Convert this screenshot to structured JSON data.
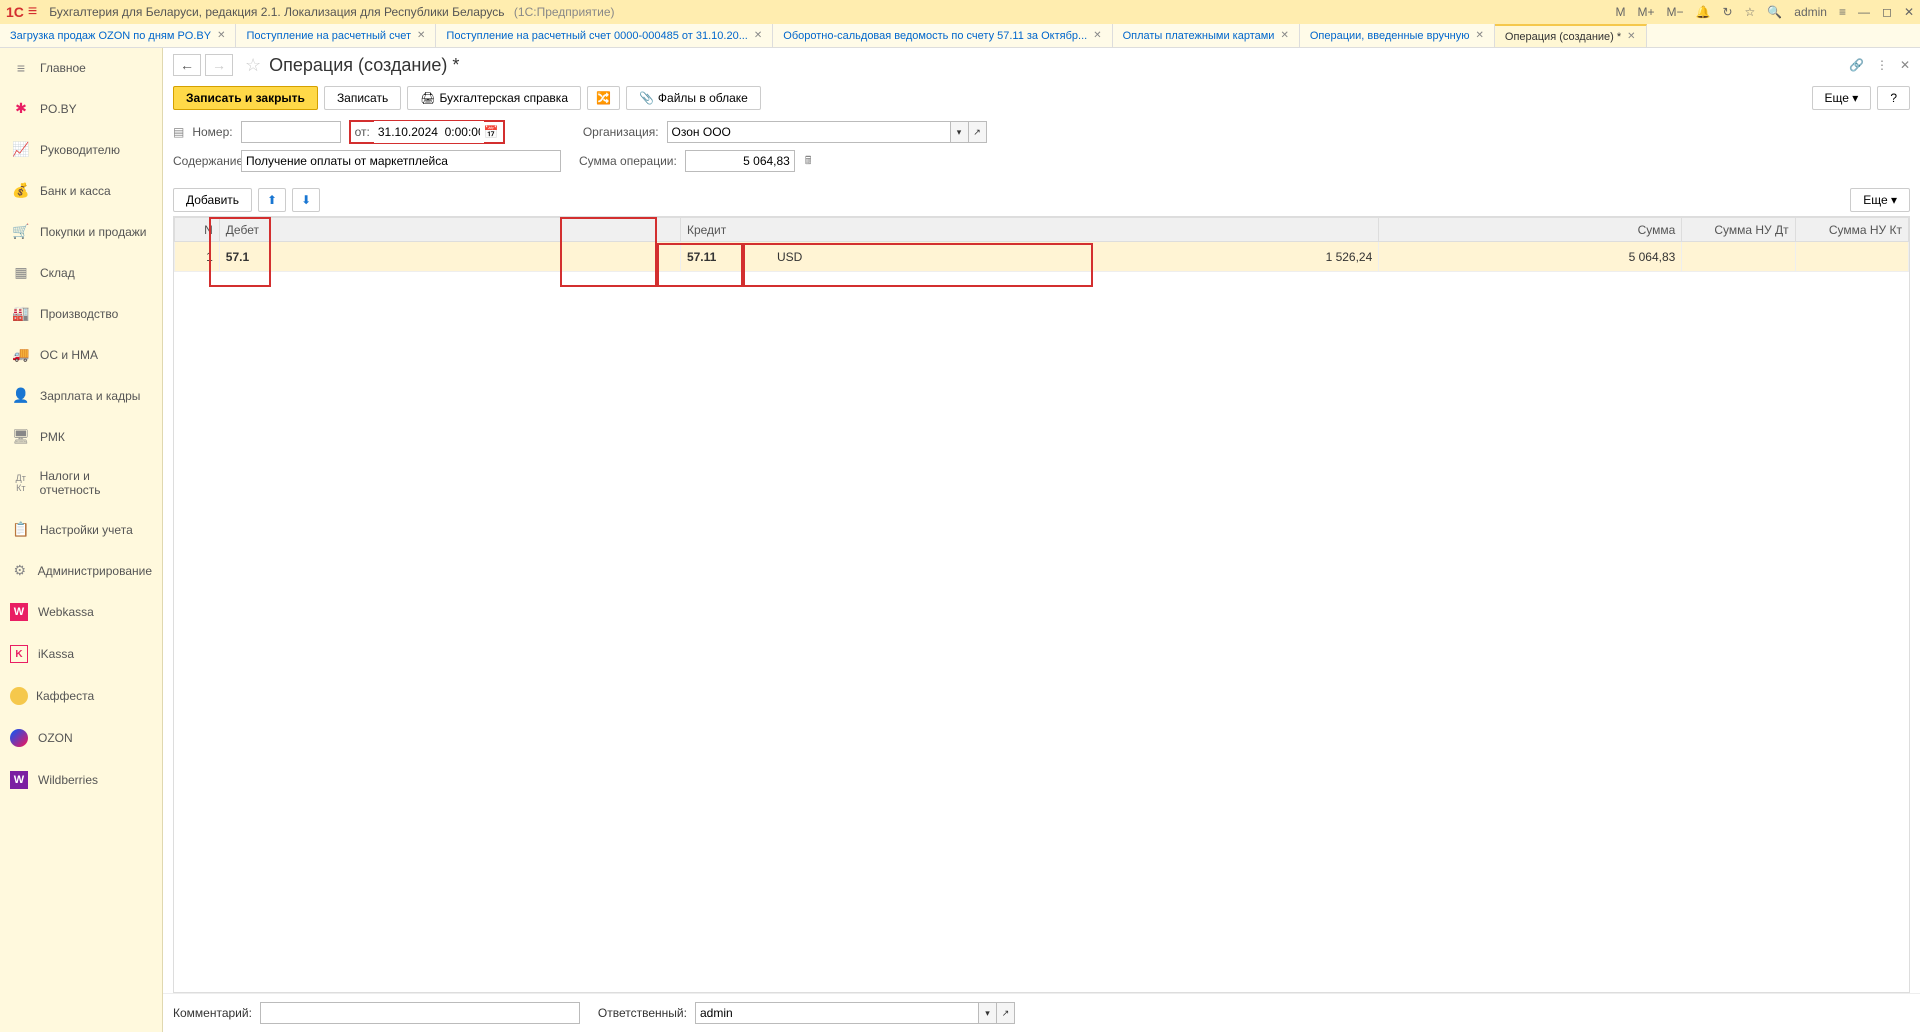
{
  "app": {
    "title": "Бухгалтерия для Беларуси, редакция 2.1. Локализация для Республики Беларусь",
    "platform": "(1С:Предприятие)",
    "user": "admin"
  },
  "titlebar_icons": {
    "m": "M",
    "m_plus": "M+",
    "m_minus": "M−"
  },
  "tabs": [
    {
      "label": "Загрузка продаж OZON по дням PO.BY",
      "active": false
    },
    {
      "label": "Поступление на расчетный счет",
      "active": false
    },
    {
      "label": "Поступление на расчетный счет 0000-000485 от 31.10.20...",
      "active": false
    },
    {
      "label": "Оборотно-сальдовая ведомость по счету 57.11 за Октябр...",
      "active": false
    },
    {
      "label": "Оплаты платежными картами",
      "active": false
    },
    {
      "label": "Операции, введенные вручную",
      "active": false
    },
    {
      "label": "Операция (создание) *",
      "active": true
    }
  ],
  "sidebar": [
    {
      "icon": "≡",
      "label": "Главное"
    },
    {
      "icon": "✱",
      "label": "PO.BY"
    },
    {
      "icon": "📈",
      "label": "Руководителю"
    },
    {
      "icon": "💰",
      "label": "Банк и касса"
    },
    {
      "icon": "🛒",
      "label": "Покупки и продажи"
    },
    {
      "icon": "▦",
      "label": "Склад"
    },
    {
      "icon": "🏭",
      "label": "Производство"
    },
    {
      "icon": "🚚",
      "label": "ОС и НМА"
    },
    {
      "icon": "👤",
      "label": "Зарплата и кадры"
    },
    {
      "icon": "🖥",
      "label": "РМК"
    },
    {
      "icon": "Дт",
      "label": "Налоги и отчетность"
    },
    {
      "icon": "📋",
      "label": "Настройки учета"
    },
    {
      "icon": "⚙",
      "label": "Администрирование"
    },
    {
      "icon": "W",
      "label": "Webkassa"
    },
    {
      "icon": "K",
      "label": "iKassa"
    },
    {
      "icon": "●",
      "label": "Каффеста"
    },
    {
      "icon": "O",
      "label": "OZON"
    },
    {
      "icon": "W",
      "label": "Wildberries"
    }
  ],
  "page": {
    "title": "Операция (создание) *",
    "save_close": "Записать и закрыть",
    "save": "Записать",
    "accounting_ref": "Бухгалтерская справка",
    "files_cloud": "Файлы в облаке",
    "more": "Еще",
    "help": "?"
  },
  "form": {
    "number_label": "Номер:",
    "number_value": "",
    "date_label": "от:",
    "date_value": "31.10.2024  0:00:00",
    "org_label": "Организация:",
    "org_value": "Озон ООО",
    "content_label": "Содержание:",
    "content_value": "Получение оплаты от маркетплейса",
    "sum_label": "Сумма операции:",
    "sum_value": "5 064,83"
  },
  "table_toolbar": {
    "add": "Добавить",
    "up": "⬆",
    "down": "⬇",
    "more": "Еще"
  },
  "table": {
    "headers": {
      "n": "N",
      "debit": "Дебет",
      "credit": "Кредит",
      "sum": "Сумма",
      "nu_dt": "Сумма НУ Дт",
      "nu_kt": "Сумма НУ Кт"
    },
    "rows": [
      {
        "n": "1",
        "debit_acc": "57.1",
        "credit_acc": "57.11",
        "credit_cur": "USD",
        "credit_amt": "1 526,24",
        "sum": "5 064,83",
        "nu_dt": "",
        "nu_kt": ""
      }
    ]
  },
  "footer": {
    "comment_label": "Комментарий:",
    "comment_value": "",
    "responsible_label": "Ответственный:",
    "responsible_value": "admin"
  }
}
